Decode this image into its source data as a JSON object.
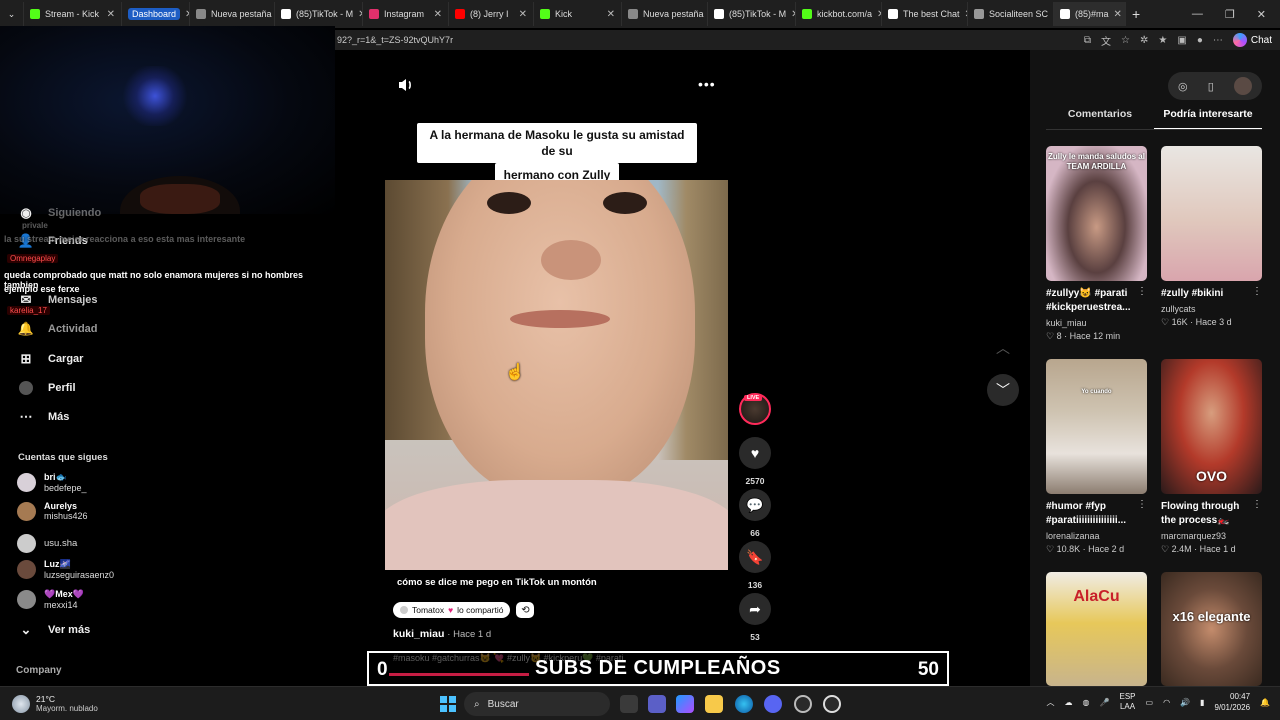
{
  "browser": {
    "tabs": [
      {
        "label": "Stream - Kick",
        "icon_color": "#53fc18",
        "active": false
      },
      {
        "label": "Dashboard",
        "icon_color": "#1d5dc4",
        "active": false,
        "badge": true
      },
      {
        "label": "Nueva pestaña",
        "icon_color": "#888888",
        "active": false
      },
      {
        "label": "(85)TikTok - M",
        "icon_color": "#ffffff",
        "active": false
      },
      {
        "label": "Instagram",
        "icon_color": "#e1306c",
        "active": false
      },
      {
        "label": "(8) Jerry I",
        "icon_color": "#ff0000",
        "active": false
      },
      {
        "label": "Kick",
        "icon_color": "#53fc18",
        "active": false
      },
      {
        "label": "Nueva pestaña",
        "icon_color": "#888888",
        "active": false
      },
      {
        "label": "(85)TikTok - M",
        "icon_color": "#ffffff",
        "active": false
      },
      {
        "label": "kickbot.com/a",
        "icon_color": "#53fc18",
        "active": false
      },
      {
        "label": "The best Chat",
        "icon_color": "#ffffff",
        "active": false
      },
      {
        "label": "Socialiteen SC",
        "icon_color": "#999999",
        "active": false
      },
      {
        "label": "(85)#ma",
        "icon_color": "#ffffff",
        "active": true
      }
    ],
    "new_tab": "+",
    "url": "92?_r=1&_t=ZS-92tvQUhY7r",
    "chat_label": "Chat"
  },
  "sidebar": {
    "nav": [
      {
        "label": "Friends",
        "icon": "users-icon"
      },
      {
        "label": "Mensajes",
        "icon": "inbox-icon"
      },
      {
        "label": "Actividad",
        "icon": "bell-icon"
      },
      {
        "label": "Cargar",
        "icon": "plus-square-icon"
      },
      {
        "label": "Perfil",
        "icon": "profile-icon"
      },
      {
        "label": "Más",
        "icon": "more-icon"
      }
    ],
    "faded_top": "Siguiendo",
    "chat": {
      "user1": "privale",
      "line1": "la                    su stream mejor reacciona a eso esta mas interesante",
      "user2": "Omnegaplay",
      "line2": "queda comprobado que matt no solo enamora mujeres si no hombres tambien",
      "line3": "ejemplo ese ferxe",
      "user3": "karelia_17"
    },
    "following_title": "Cuentas que sigues",
    "accounts": [
      {
        "name": "bri🐟",
        "handle": "bedefepe_"
      },
      {
        "name": "Aurelys",
        "handle": "mishus426"
      },
      {
        "name": "usu.sha",
        "handle": ""
      },
      {
        "name": "Luz🌌",
        "handle": "luzseguirasaenz0"
      },
      {
        "name": "💜Mex💜",
        "handle": "mexxi14"
      }
    ],
    "see_more": "Ver más",
    "company": "Company"
  },
  "video": {
    "caption_line1": "A la hermana de Masoku le gusta su amistad de su",
    "caption_line2": "hermano con Zully",
    "description": "cómo se dice me pego en TikTok un montón",
    "shared_by": "Tomatox",
    "shared_text": "lo compartió",
    "author": "kuki_miau",
    "posted": "Hace 1 d",
    "live_badge": "LIVE",
    "actions": [
      {
        "name": "like",
        "count": "2570"
      },
      {
        "name": "comment",
        "count": "66"
      },
      {
        "name": "bookmark",
        "count": "136"
      },
      {
        "name": "share",
        "count": "53"
      }
    ]
  },
  "subs_banner": {
    "current": "0",
    "title": "SUBS DE CUMPLEAÑOS",
    "goal": "50",
    "tags_overlay": "#masoku #gatchurras😺 💘 #zully😺 #kickperu💚 #parati"
  },
  "right_panel": {
    "tabs": [
      "Comentarios",
      "Podría interesarte"
    ],
    "active_tab": 1,
    "cards": [
      {
        "title": "#zullyy😺 #parati #kickperuestrea...",
        "author": "kuki_miau",
        "likes": "8",
        "time": "Hace 12 min",
        "thumb_text": "Zully le manda saludos al TEAM ARDILLA"
      },
      {
        "title": "#zully #bikini",
        "author": "zullycats",
        "likes": "16K",
        "time": "Hace 3 d",
        "thumb_text": ""
      },
      {
        "title": "#humor #fyp #paratiiiiiiiiiiiiiii...",
        "author": "lorenalizanaa",
        "likes": "10.8K",
        "time": "Hace 2 d",
        "thumb_text": "Yo cuando"
      },
      {
        "title": "Flowing through the process🏍️",
        "author": "marcmarquez93",
        "likes": "2.4M",
        "time": "Hace 1 d",
        "thumb_text": "OVO"
      },
      {
        "title": "",
        "author": "",
        "likes": "",
        "time": "",
        "thumb_text": "AlaCu"
      },
      {
        "title": "",
        "author": "",
        "likes": "",
        "time": "",
        "thumb_text": "x16 elegante"
      }
    ]
  },
  "taskbar": {
    "temp": "21°C",
    "weather": "Mayorm. nublado",
    "search": "Buscar",
    "lang1": "ESP",
    "lang2": "LAA",
    "time": "00:47",
    "date": "9/01/2026"
  }
}
